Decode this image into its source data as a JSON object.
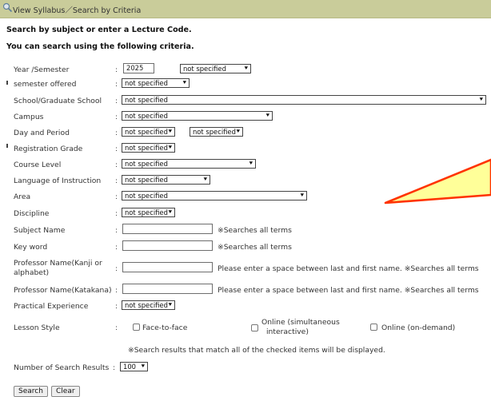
{
  "header": {
    "title": "View Syllabus／Search by Criteria",
    "icon": "search-icon"
  },
  "intro": {
    "line1": "Search by subject or enter a Lecture Code.",
    "line2": "You can search using the following criteria."
  },
  "colon": ":",
  "form": {
    "year_semester": {
      "label": "Year /Semester",
      "year_value": "2025",
      "semester_value": "not specified"
    },
    "semester_offered": {
      "label": "semester offered",
      "value": "not specified"
    },
    "school": {
      "label": "School/Graduate School",
      "value": "not specified"
    },
    "campus": {
      "label": "Campus",
      "value": "not specified"
    },
    "day_period": {
      "label": "Day and Period",
      "day_value": "not specified",
      "period_value": "not specified"
    },
    "registration_grade": {
      "label": "Registration Grade",
      "value": "not specified"
    },
    "course_level": {
      "label": "Course Level",
      "value": "not specified"
    },
    "language": {
      "label": "Language of Instruction",
      "value": "not specified"
    },
    "area": {
      "label": "Area",
      "value": "not specified"
    },
    "discipline": {
      "label": "Discipline",
      "value": "not specified"
    },
    "subject_name": {
      "label": "Subject Name",
      "value": "",
      "hint": "※Searches all terms"
    },
    "keyword": {
      "label": "Key word",
      "value": "",
      "hint": "※Searches all terms"
    },
    "professor_kanji": {
      "label_line1": "Professor Name(Kanji or",
      "label_line2": "alphabet)",
      "value": "",
      "hint": "Please enter a space between last and first name.  ※Searches all terms"
    },
    "professor_katakana": {
      "label": "Professor Name(Katakana)",
      "value": "",
      "hint": "Please enter a space between last and first name.  ※Searches all terms"
    },
    "practical_experience": {
      "label": "Practical Experience",
      "value": "not specified"
    },
    "lesson_style": {
      "label": "Lesson Style",
      "options": [
        {
          "line1": "Face-to-face",
          "line2": "",
          "checked": false
        },
        {
          "line1": "Online (simultaneous",
          "line2": "interactive)",
          "checked": false
        },
        {
          "line1": "Online (on-demand)",
          "line2": "",
          "checked": false
        }
      ]
    },
    "note": "※Search results that match all of the checked items will be displayed.",
    "num_results": {
      "label": "Number of Search Results",
      "value": "100"
    }
  },
  "buttons": {
    "search": "Search",
    "clear": "Clear"
  },
  "chevron": "⯆",
  "annotation_arrow": {
    "fill": "#ffff99",
    "stroke": "#ff3300"
  },
  "colors": {
    "titlebar": "#c9cc9a"
  }
}
